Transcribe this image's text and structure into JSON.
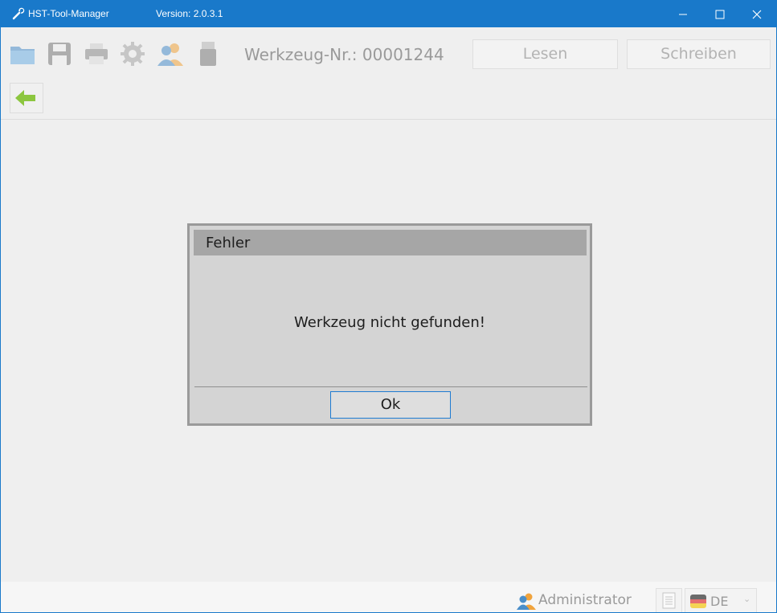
{
  "titlebar": {
    "app_name": "HST-Tool-Manager",
    "version": "Version: 2.0.3.1",
    "background": "#1979ca"
  },
  "window_controls": [
    "minimize-icon",
    "maximize-icon",
    "close-icon"
  ],
  "toolbar": {
    "icons": [
      "open-folder-icon",
      "save-icon",
      "print-icon",
      "settings-gear-icon",
      "user-icon",
      "usb-drive-icon"
    ],
    "werkzeug_label": "Werkzeug-Nr.: 00001244",
    "read_button": "Lesen",
    "write_button": "Schreiben"
  },
  "nav": {
    "back_icon": "arrow-left-icon",
    "arrow_color": "#8cc63f"
  },
  "dialog": {
    "title": "Fehler",
    "message": "Werkzeug nicht gefunden!",
    "ok_button": "Ok",
    "focus_color": "#1f7bd1"
  },
  "statusbar": {
    "user": "Administrator",
    "doc_icon": "document-icon",
    "language": "DE",
    "language_icon": "german-flag-icon"
  }
}
